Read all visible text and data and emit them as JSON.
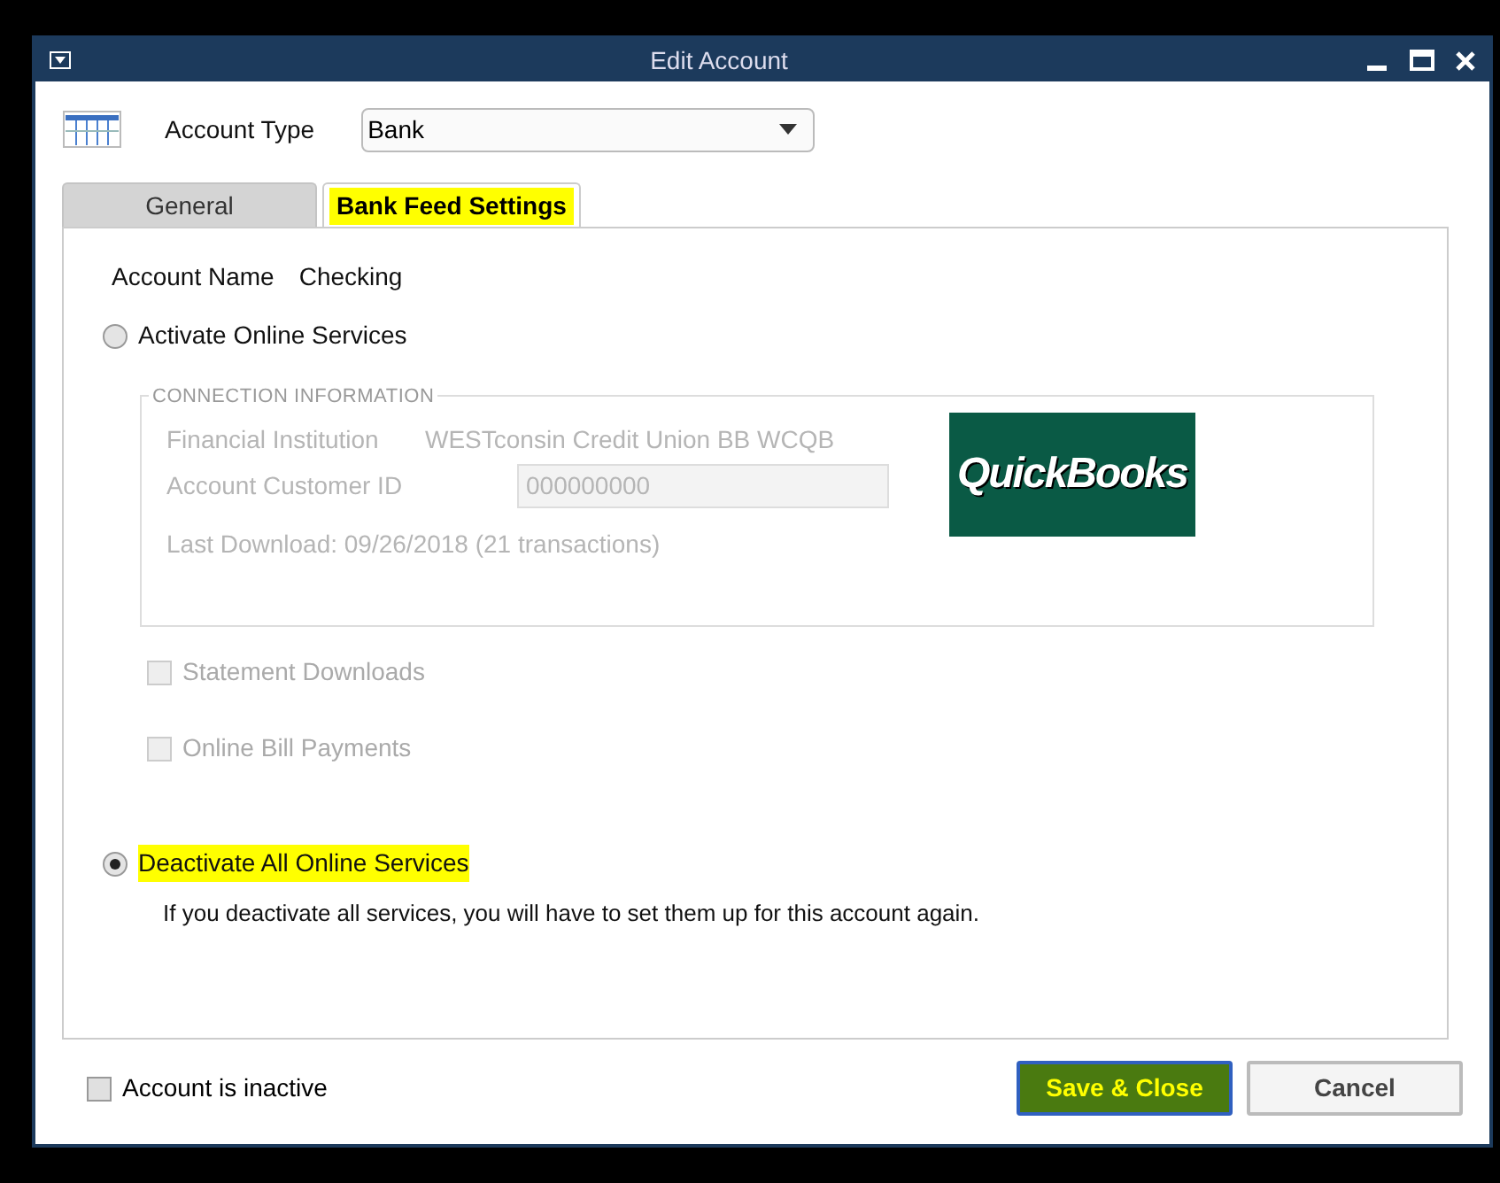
{
  "window": {
    "title": "Edit Account"
  },
  "account_type": {
    "label": "Account Type",
    "value": "Bank"
  },
  "tabs": [
    {
      "label": "General",
      "selected": false,
      "highlighted": false
    },
    {
      "label": "Bank Feed Settings",
      "selected": true,
      "highlighted": true
    }
  ],
  "account_name": {
    "label": "Account Name",
    "value": "Checking"
  },
  "activate_option": {
    "label": "Activate Online Services",
    "selected": false,
    "highlighted": false
  },
  "connection_info": {
    "title": "CONNECTION INFORMATION",
    "disabled": true,
    "financial_institution": {
      "label": "Financial Institution",
      "value": "WESTconsin Credit Union BB WCQB"
    },
    "customer_id": {
      "label": "Account Customer ID",
      "value": "000000000"
    },
    "last_download": "Last Download: 09/26/2018 (21 transactions)",
    "logo": "QuickBooks"
  },
  "services": [
    {
      "label": "Statement Downloads",
      "checked": false,
      "disabled": true
    },
    {
      "label": "Online Bill Payments",
      "checked": false,
      "disabled": true
    }
  ],
  "deactivate_option": {
    "label": "Deactivate All Online Services",
    "selected": true,
    "highlighted": true,
    "note": "If you deactivate all services, you will have to set them up for this account again."
  },
  "inactive": {
    "label": "Account is inactive",
    "checked": false
  },
  "buttons": [
    {
      "label": "Save & Close",
      "kind": "primary",
      "highlighted": true
    },
    {
      "label": "Cancel",
      "kind": "secondary",
      "highlighted": false
    }
  ]
}
